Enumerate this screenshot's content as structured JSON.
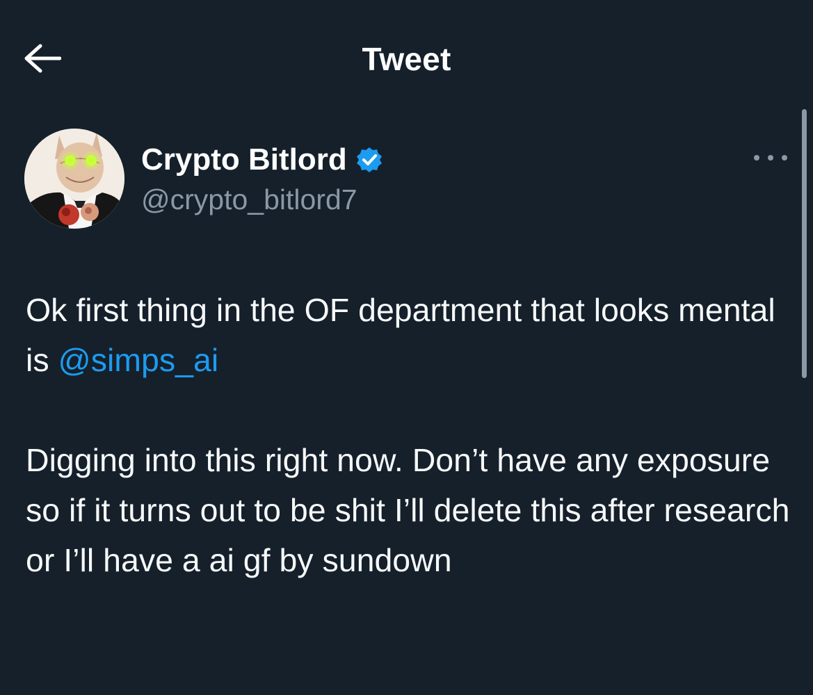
{
  "header": {
    "title": "Tweet",
    "back_icon": "arrow-left-icon"
  },
  "tweet": {
    "author": {
      "display_name": "Crypto Bitlord",
      "handle": "@crypto_bitlord7",
      "verified": true,
      "verified_badge_color": "#1d9bf0"
    },
    "more_icon": "more-horizontal-icon",
    "body": {
      "para1_text": "Ok first thing in the OF department that looks mental is ",
      "para1_mention": "@simps_ai",
      "para2_text": "Digging into this right now. Don’t have any exposure so if it turns out to be shit I’ll delete this after research or I’ll have a ai gf by sundown"
    }
  },
  "colors": {
    "background": "#15202b",
    "primary_text": "#ffffff",
    "secondary_text": "#8b98a5",
    "link": "#1d9bf0"
  }
}
